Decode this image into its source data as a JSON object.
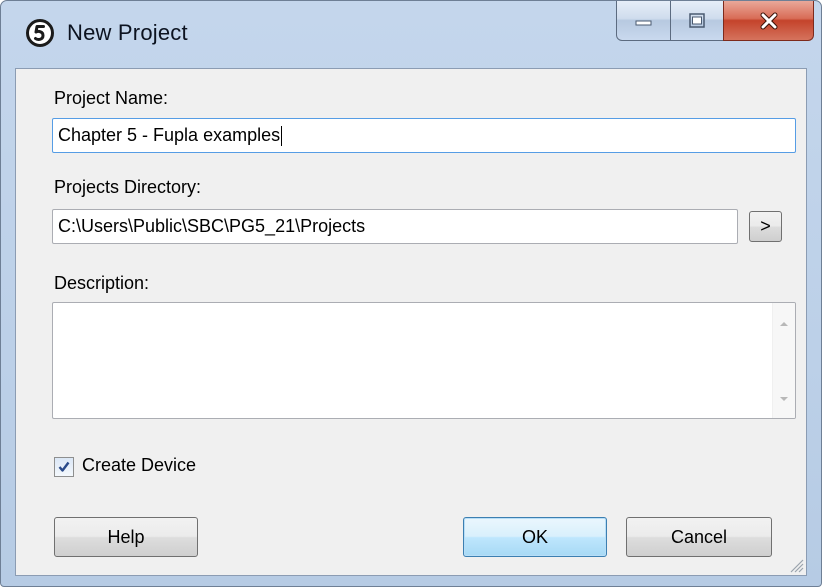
{
  "window": {
    "title": "New Project",
    "icon": "pg5-app-icon",
    "controls": {
      "minimize_icon": "minimize-icon",
      "maximize_icon": "maximize-icon",
      "close_icon": "close-icon"
    },
    "colors": {
      "frame": "#c4d6ec",
      "close_button": "#c4432b",
      "client": "#f0f0f0"
    }
  },
  "form": {
    "project_name": {
      "label": "Project Name:",
      "value": "Chapter 5 - Fupla examples"
    },
    "projects_directory": {
      "label": "Projects Directory:",
      "value": "C:\\Users\\Public\\SBC\\PG5_21\\Projects",
      "browse_label": ">"
    },
    "description": {
      "label": "Description:",
      "value": ""
    },
    "create_device": {
      "label": "Create Device",
      "checked": true
    }
  },
  "buttons": {
    "help": "Help",
    "ok": "OK",
    "cancel": "Cancel"
  }
}
